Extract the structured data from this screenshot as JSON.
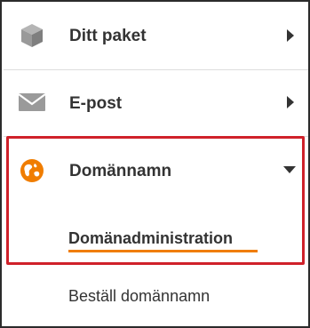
{
  "menu": {
    "items": [
      {
        "label": "Ditt paket",
        "icon": "package-icon",
        "state": "collapsed"
      },
      {
        "label": "E-post",
        "icon": "envelope-icon",
        "state": "collapsed"
      },
      {
        "label": "Domännamn",
        "icon": "globe-icon",
        "state": "expanded",
        "subitems": [
          {
            "label": "Domänadministration",
            "active": true
          },
          {
            "label": "Beställ domännamn",
            "active": false
          }
        ]
      }
    ]
  },
  "colors": {
    "highlight_border": "#d0212a",
    "accent_orange": "#f07d00",
    "icon_gray": "#9a9a9a",
    "text": "#333333"
  }
}
